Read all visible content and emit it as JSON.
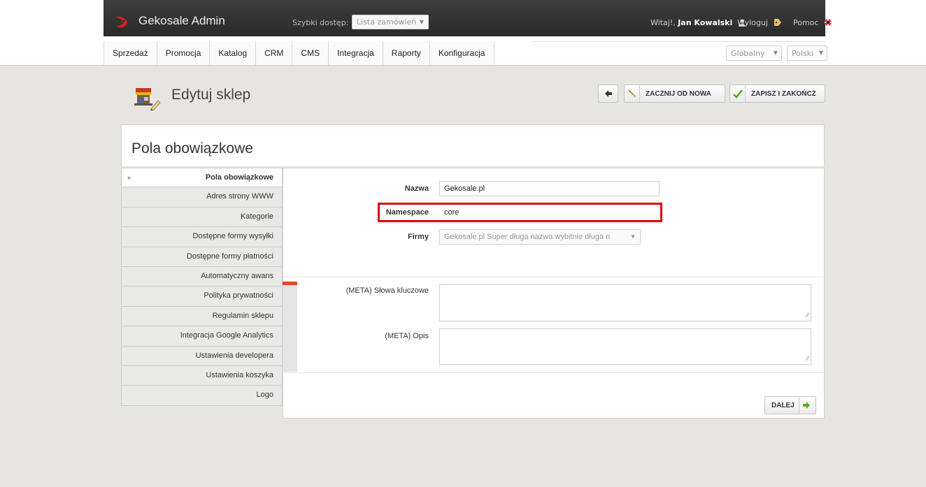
{
  "app": {
    "title": "Gekosale Admin",
    "quick_access_label": "Szybki dostęp:",
    "quick_access_value": "Lista zamówień",
    "greeting_prefix": "Witaj!,",
    "user_name": "Jan Kowalski",
    "logout_label": "Wyloguj",
    "help_label": "Pomoc"
  },
  "menu": {
    "items": [
      "Sprzedaż",
      "Promocja",
      "Katalog",
      "CRM",
      "CMS",
      "Integracja",
      "Raporty",
      "Konfiguracja"
    ],
    "scope_value": "Globalny",
    "language_value": "Polski"
  },
  "page": {
    "title": "Edytuj sklep",
    "reset_label": "ZACZNIJ OD NOWA",
    "save_label": "ZAPISZ I ZAKOŃCZ",
    "panel_title": "Pola obowiązkowe"
  },
  "sidebar": {
    "items": [
      {
        "label": "Pola obowiązkowe",
        "active": true
      },
      {
        "label": "Adres strony WWW"
      },
      {
        "label": "Kategorie"
      },
      {
        "label": "Dostępne formy wysyłki"
      },
      {
        "label": "Dostępne formy płatności"
      },
      {
        "label": "Automatyczny awans"
      },
      {
        "label": "Polityka prywatności"
      },
      {
        "label": "Regulamin sklepu"
      },
      {
        "label": "Integracja Google Analytics"
      },
      {
        "label": "Ustawienia developera"
      },
      {
        "label": "Ustawienia koszyka"
      },
      {
        "label": "Logo"
      }
    ],
    "chevron": "»"
  },
  "form": {
    "name_label": "Nazwa",
    "name_value": "Gekosale.pl",
    "namespace_label": "Namespace",
    "namespace_value": "core",
    "company_label": "Firmy",
    "company_value": "Gekosale.pl Super długa nazwa wybitnie długa n",
    "meta_keywords_label": "(META) Słowa kluczowe",
    "meta_keywords_value": "",
    "meta_description_label": "(META) Opis",
    "meta_description_value": "",
    "next_label": "DALEJ"
  },
  "colors": {
    "accent_red": "#e00000",
    "brand_red": "#d6201f",
    "green_check": "#5aaa1e"
  }
}
